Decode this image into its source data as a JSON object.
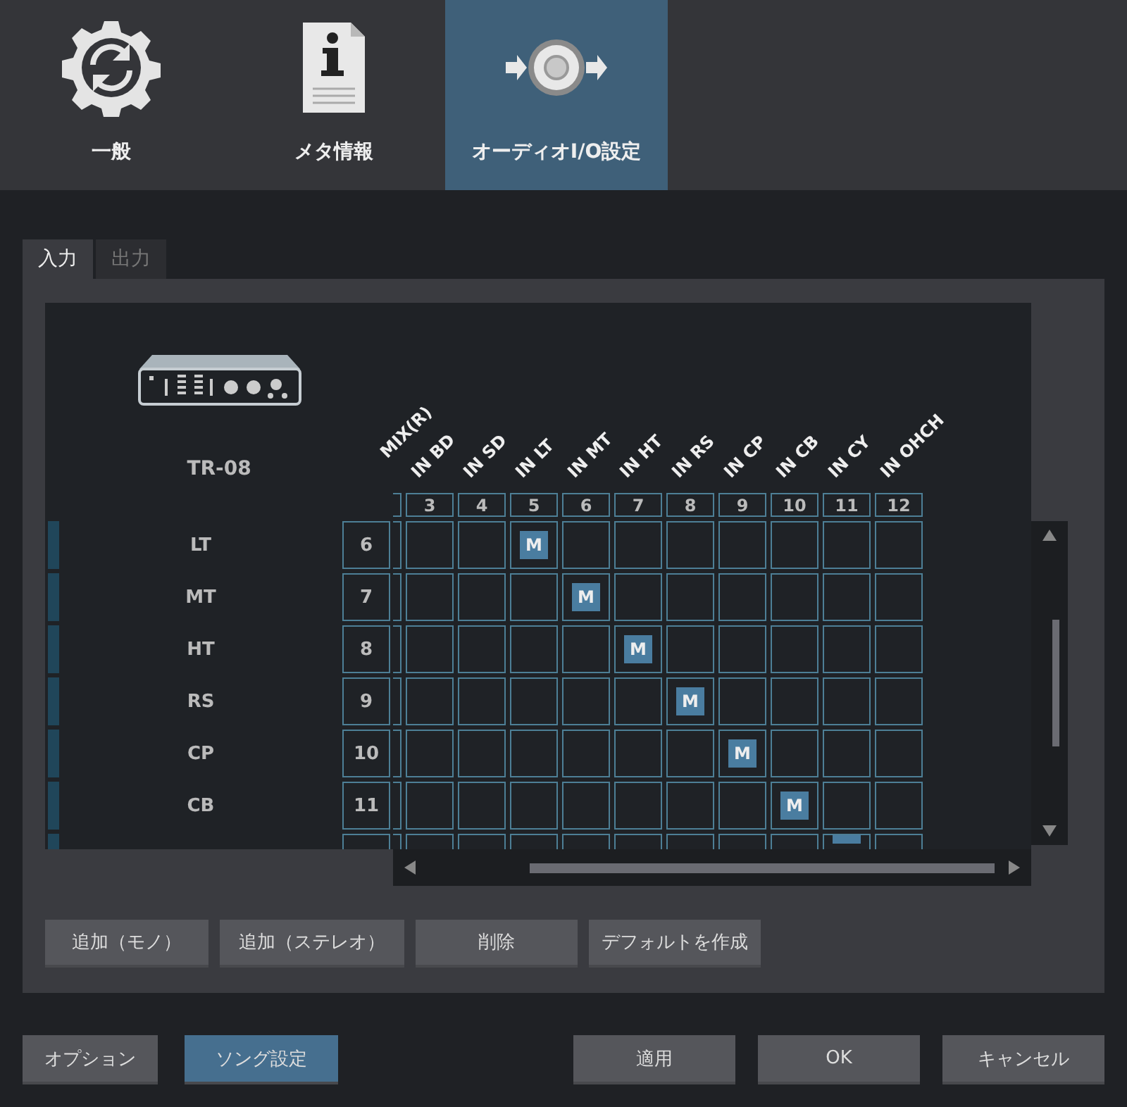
{
  "tabs": [
    {
      "label": "一般",
      "selected": false
    },
    {
      "label": "メタ情報",
      "selected": false
    },
    {
      "label": "オーディオI/O設定",
      "selected": true
    }
  ],
  "subtabs": [
    {
      "label": "入力",
      "selected": true
    },
    {
      "label": "出力",
      "selected": false
    }
  ],
  "device": {
    "name": "TR-08"
  },
  "matrix": {
    "partial_column_label": "MIX(R)",
    "columns": [
      {
        "label": "IN BD",
        "number": "3"
      },
      {
        "label": "IN SD",
        "number": "4"
      },
      {
        "label": "IN LT",
        "number": "5"
      },
      {
        "label": "IN MT",
        "number": "6"
      },
      {
        "label": "IN HT",
        "number": "7"
      },
      {
        "label": "IN RS",
        "number": "8"
      },
      {
        "label": "IN CP",
        "number": "9"
      },
      {
        "label": "IN CB",
        "number": "10"
      },
      {
        "label": "IN CY",
        "number": "11"
      },
      {
        "label": "IN OHCH",
        "number": "12"
      }
    ],
    "rows": [
      {
        "label": "LT",
        "number": "6",
        "cells": [
          {
            "assigned": false
          },
          {
            "assigned": false
          },
          {
            "assigned": true,
            "mark": "M"
          },
          {
            "assigned": false
          },
          {
            "assigned": false
          },
          {
            "assigned": false
          },
          {
            "assigned": false
          },
          {
            "assigned": false
          },
          {
            "assigned": false
          },
          {
            "assigned": false
          }
        ]
      },
      {
        "label": "MT",
        "number": "7",
        "cells": [
          {
            "assigned": false
          },
          {
            "assigned": false
          },
          {
            "assigned": false
          },
          {
            "assigned": true,
            "mark": "M"
          },
          {
            "assigned": false
          },
          {
            "assigned": false
          },
          {
            "assigned": false
          },
          {
            "assigned": false
          },
          {
            "assigned": false
          },
          {
            "assigned": false
          }
        ]
      },
      {
        "label": "HT",
        "number": "8",
        "cells": [
          {
            "assigned": false
          },
          {
            "assigned": false
          },
          {
            "assigned": false
          },
          {
            "assigned": false
          },
          {
            "assigned": true,
            "mark": "M"
          },
          {
            "assigned": false
          },
          {
            "assigned": false
          },
          {
            "assigned": false
          },
          {
            "assigned": false
          },
          {
            "assigned": false
          }
        ]
      },
      {
        "label": "RS",
        "number": "9",
        "cells": [
          {
            "assigned": false
          },
          {
            "assigned": false
          },
          {
            "assigned": false
          },
          {
            "assigned": false
          },
          {
            "assigned": false
          },
          {
            "assigned": true,
            "mark": "M"
          },
          {
            "assigned": false
          },
          {
            "assigned": false
          },
          {
            "assigned": false
          },
          {
            "assigned": false
          }
        ]
      },
      {
        "label": "CP",
        "number": "10",
        "cells": [
          {
            "assigned": false
          },
          {
            "assigned": false
          },
          {
            "assigned": false
          },
          {
            "assigned": false
          },
          {
            "assigned": false
          },
          {
            "assigned": false
          },
          {
            "assigned": true,
            "mark": "M"
          },
          {
            "assigned": false
          },
          {
            "assigned": false
          },
          {
            "assigned": false
          }
        ]
      },
      {
        "label": "CB",
        "number": "11",
        "cells": [
          {
            "assigned": false
          },
          {
            "assigned": false
          },
          {
            "assigned": false
          },
          {
            "assigned": false
          },
          {
            "assigned": false
          },
          {
            "assigned": false
          },
          {
            "assigned": false
          },
          {
            "assigned": true,
            "mark": "M"
          },
          {
            "assigned": false
          },
          {
            "assigned": false
          }
        ]
      },
      {
        "cells": [
          {
            "assigned": false
          },
          {
            "assigned": false
          },
          {
            "assigned": false
          },
          {
            "assigned": false
          },
          {
            "assigned": false
          },
          {
            "assigned": false
          },
          {
            "assigned": false
          },
          {
            "assigned": false
          },
          {
            "assigned": true
          },
          {
            "assigned": false
          }
        ]
      }
    ]
  },
  "panel_buttons": [
    "追加（モノ）",
    "追加（ステレオ）",
    "削除",
    "デフォルトを作成"
  ],
  "footer_left": [
    {
      "label": "オプション",
      "selected": false
    },
    {
      "label": "ソング設定",
      "selected": true
    }
  ],
  "footer_right": [
    "適用",
    "OK",
    "キャンセル"
  ]
}
